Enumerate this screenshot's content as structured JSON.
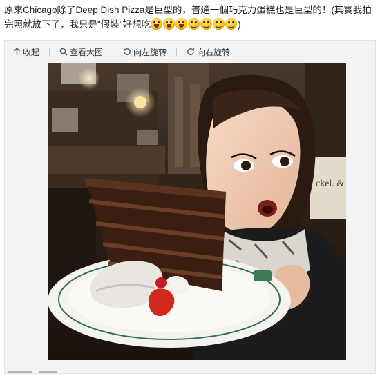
{
  "post": {
    "text": "原來Chicago除了Deep Dish Pizza是巨型的，普通一個巧克力蛋糕也是巨型的！(其實我拍完照就放下了，我只是\"假裝\"好想吃",
    "closing": ")",
    "emoji": [
      {
        "name": "open-mouth-emoji",
        "style": "open"
      },
      {
        "name": "open-mouth-emoji",
        "style": "open"
      },
      {
        "name": "open-mouth-emoji",
        "style": "open"
      },
      {
        "name": "smile-emoji",
        "style": "smile"
      },
      {
        "name": "smile-emoji",
        "style": "smile"
      },
      {
        "name": "smile-emoji",
        "style": "smile"
      },
      {
        "name": "smile-emoji",
        "style": "smile"
      }
    ]
  },
  "toolbar": {
    "collapse_label": "收起",
    "view_large_label": "查看大图",
    "rotate_left_label": "向左旋转",
    "rotate_right_label": "向右旋转"
  },
  "colors": {
    "panel_bg": "#f3f3f3",
    "emoji_yellow": "#f5b800"
  }
}
